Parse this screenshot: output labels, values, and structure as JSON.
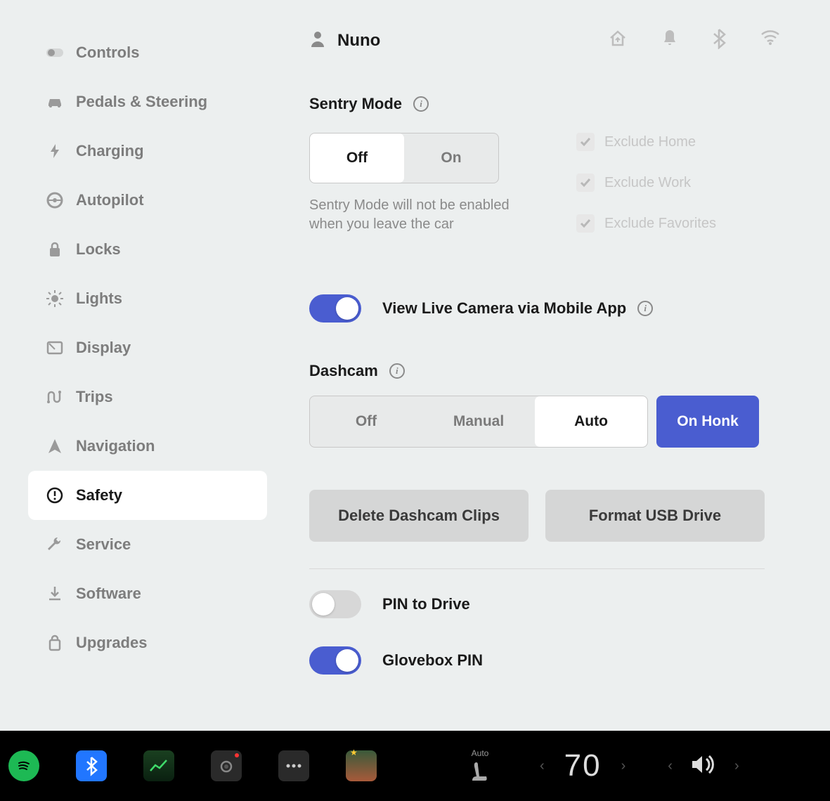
{
  "sidebar": {
    "items": [
      {
        "label": "Controls",
        "icon": "toggle-icon"
      },
      {
        "label": "Pedals & Steering",
        "icon": "car-icon"
      },
      {
        "label": "Charging",
        "icon": "bolt-icon"
      },
      {
        "label": "Autopilot",
        "icon": "wheel-icon"
      },
      {
        "label": "Locks",
        "icon": "lock-icon"
      },
      {
        "label": "Lights",
        "icon": "light-icon"
      },
      {
        "label": "Display",
        "icon": "display-icon"
      },
      {
        "label": "Trips",
        "icon": "trips-icon"
      },
      {
        "label": "Navigation",
        "icon": "nav-icon"
      },
      {
        "label": "Safety",
        "icon": "alert-icon",
        "active": true
      },
      {
        "label": "Service",
        "icon": "wrench-icon"
      },
      {
        "label": "Software",
        "icon": "download-icon"
      },
      {
        "label": "Upgrades",
        "icon": "bag-icon"
      }
    ]
  },
  "header": {
    "profile_name": "Nuno"
  },
  "sentry": {
    "title": "Sentry Mode",
    "options": {
      "off": "Off",
      "on": "On"
    },
    "selected": "Off",
    "note": "Sentry Mode will not be enabled when you leave the car",
    "exclude": [
      {
        "label": "Exclude Home",
        "checked": true
      },
      {
        "label": "Exclude Work",
        "checked": true
      },
      {
        "label": "Exclude Favorites",
        "checked": true
      }
    ]
  },
  "live_camera": {
    "label": "View Live Camera via Mobile App",
    "enabled": true
  },
  "dashcam": {
    "title": "Dashcam",
    "options": [
      "Off",
      "Manual",
      "Auto"
    ],
    "selected": "Auto",
    "honk_label": "On Honk",
    "delete_label": "Delete Dashcam Clips",
    "format_label": "Format USB Drive"
  },
  "pins": {
    "pin_to_drive": {
      "label": "PIN to Drive",
      "enabled": false
    },
    "glovebox": {
      "label": "Glovebox PIN",
      "enabled": true
    }
  },
  "bottombar": {
    "seat_mode": "Auto",
    "temp": "70"
  }
}
